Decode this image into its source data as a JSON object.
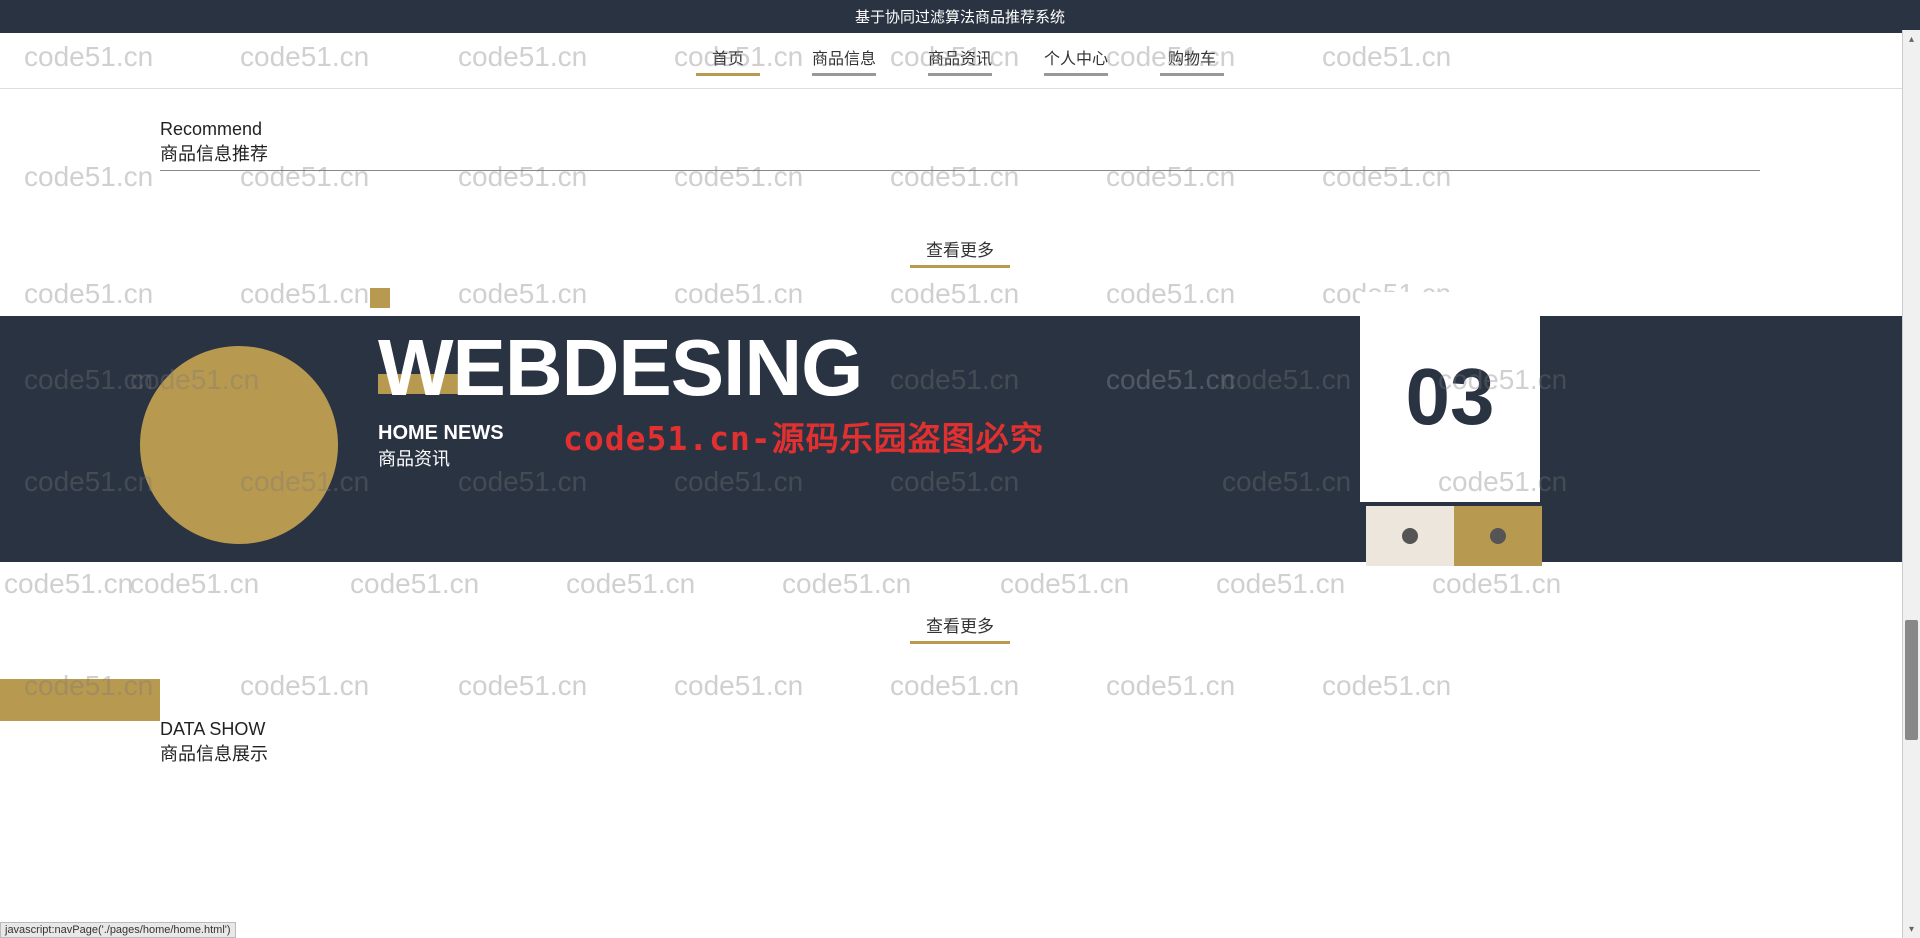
{
  "header": {
    "title": "基于协同过滤算法商品推荐系统"
  },
  "nav": {
    "items": [
      {
        "label": "首页",
        "active": true
      },
      {
        "label": "商品信息"
      },
      {
        "label": "商品资讯"
      },
      {
        "label": "个人中心"
      },
      {
        "label": "购物车"
      }
    ]
  },
  "section1": {
    "en": "Recommend",
    "cn": "商品信息推荐",
    "more": "查看更多"
  },
  "banner": {
    "title": "WEBDESING",
    "sub_en": "HOME NEWS",
    "sub_cn": "商品资讯",
    "count": "03",
    "more": "查看更多",
    "overlay": "code51.cn-源码乐园盗图必究"
  },
  "section2": {
    "en": "DATA SHOW",
    "cn": "商品信息展示"
  },
  "watermark": "code51.cn",
  "statusbar": "javascript:navPage('./pages/home/home.html')"
}
